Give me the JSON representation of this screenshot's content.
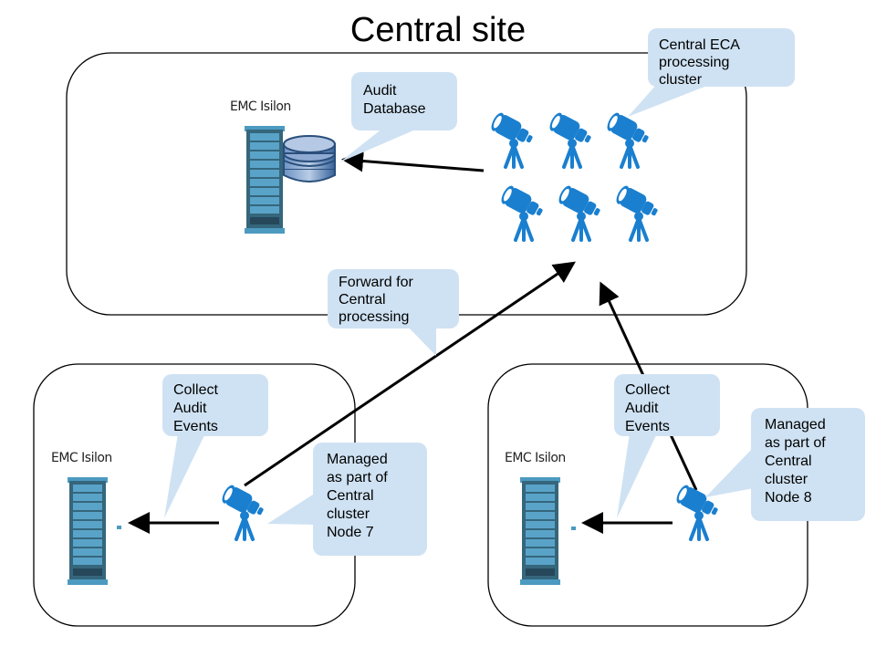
{
  "title": "Central site",
  "colors": {
    "callout_fill": "#cfe2f3",
    "telescope": "#1a7fcf",
    "server_frame": "#3b6f86",
    "server_slot": "#5aa3c8",
    "database": "#4a78b0",
    "arrow": "#000000"
  },
  "sites": {
    "central": {
      "storage_label": "EMC Isilon",
      "callouts": {
        "audit_database": [
          "Audit",
          "Database"
        ],
        "processing_cluster": [
          "Central ECA",
          "processing",
          "cluster"
        ]
      },
      "icons": [
        "server-rack-icon",
        "database-icon",
        "telescope-icon"
      ]
    },
    "remote_left": {
      "storage_label": "EMC Isilon",
      "callouts": {
        "collect": [
          "Collect",
          "Audit",
          "Events"
        ],
        "managed": [
          "Managed",
          "as part of",
          "Central",
          "cluster",
          "Node 7"
        ]
      }
    },
    "remote_right": {
      "storage_label": "EMC Isilon",
      "callouts": {
        "collect": [
          "Collect",
          "Audit",
          "Events"
        ],
        "managed": [
          "Managed",
          "as part of",
          "Central",
          "cluster",
          "Node 8"
        ]
      }
    }
  },
  "forward_callout": [
    "Forward for",
    "Central",
    "processing"
  ]
}
